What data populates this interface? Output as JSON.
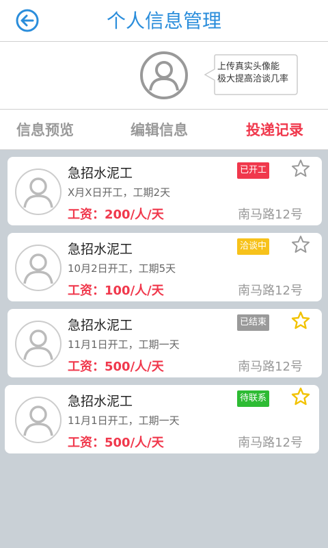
{
  "header": {
    "title": "个人信息管理",
    "back_icon": "back-arrow-icon"
  },
  "profile": {
    "tooltip_line1": "上传真实头像能",
    "tooltip_line2": "极大提高洽谈几率"
  },
  "tabs": [
    {
      "label": "信息预览",
      "active": false
    },
    {
      "label": "编辑信息",
      "active": false
    },
    {
      "label": "投递记录",
      "active": true
    }
  ],
  "records": [
    {
      "title": "急招水泥工",
      "date": "X月X日开工，工期2天",
      "salary": "工资：200/人/天",
      "location": "南马路12号",
      "status": "已开工",
      "status_color": "#f0384c",
      "starred": false
    },
    {
      "title": "急招水泥工",
      "date": "10月2日开工，工期5天",
      "salary": "工资：100/人/天",
      "location": "南马路12号",
      "status": "洽谈中",
      "status_color": "#f7c21b",
      "starred": false
    },
    {
      "title": "急招水泥工",
      "date": "11月1日开工，工期一天",
      "salary": "工资：500/人/天",
      "location": "南马路12号",
      "status": "已结束",
      "status_color": "#9a9a9a",
      "starred": true
    },
    {
      "title": "急招水泥工",
      "date": "11月1日开工，工期一天",
      "salary": "工资：500/人/天",
      "location": "南马路12号",
      "status": "待联系",
      "status_color": "#2dbb33",
      "starred": true
    }
  ]
}
